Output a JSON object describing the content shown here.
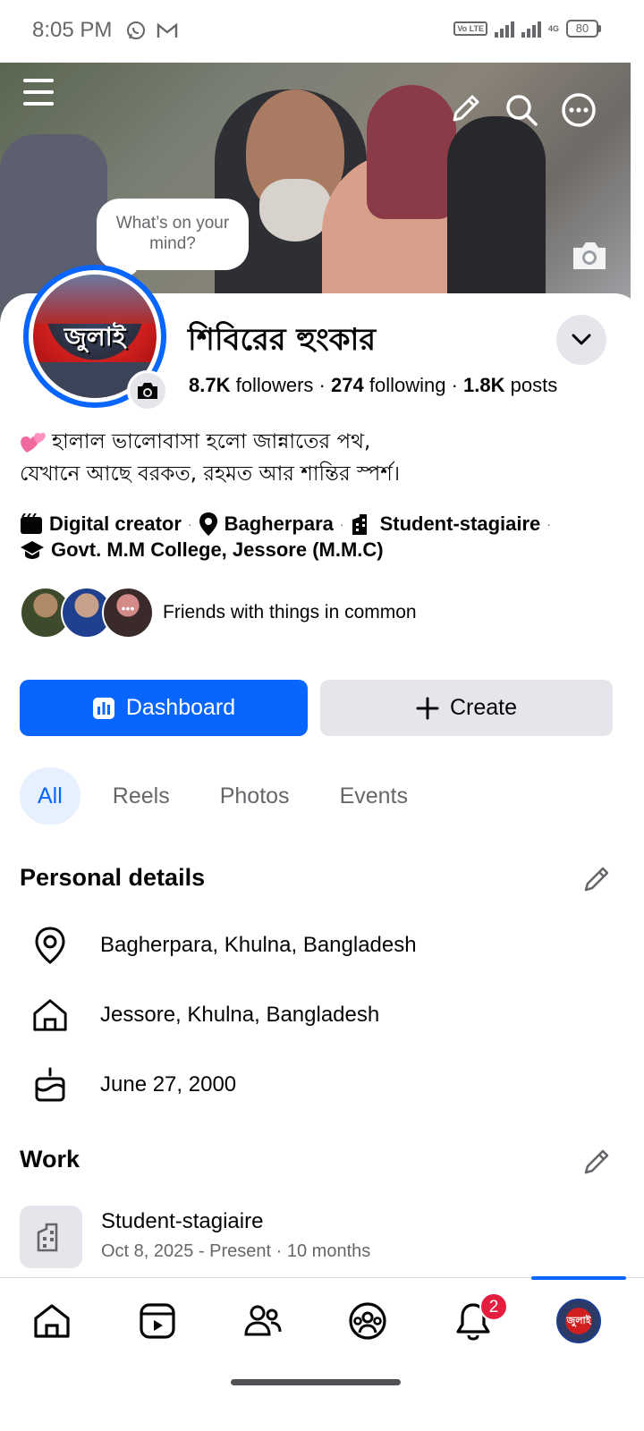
{
  "status_bar": {
    "time": "8:05 PM",
    "left_icons": [
      "whatsapp-icon",
      "gmail-icon"
    ],
    "volte": "Vo LTE",
    "network_label": "4G",
    "battery": "80"
  },
  "cover": {
    "prompt": "What’s on your mind?"
  },
  "profile": {
    "name": "শিবিরের হুংকার",
    "avatar_text": "জুলাই",
    "followers_count": "8.7K",
    "followers_label": "followers",
    "following_count": "274",
    "following_label": "following",
    "posts_count": "1.8K",
    "posts_label": "posts",
    "bio_line1": "হালাল ভালোবাসা হলো জান্নাতের পথ,",
    "bio_line2": "যেখানে আছে বরকত, রহমত আর শান্তির স্পর্শ।",
    "tags": {
      "category": "Digital creator",
      "location": "Bagherpara",
      "work": "Student-stagiaire",
      "education": "Govt. M.M College, Jessore (M.M.C)"
    },
    "friends_text": "Friends with things in common"
  },
  "actions": {
    "dashboard": "Dashboard",
    "create": "Create"
  },
  "tabs": [
    "All",
    "Reels",
    "Photos",
    "Events"
  ],
  "personal_details": {
    "title": "Personal details",
    "lives_in": "Bagherpara, Khulna, Bangladesh",
    "from": "Jessore, Khulna, Bangladesh",
    "birthday": "June 27, 2000"
  },
  "work": {
    "title": "Work",
    "position": "Student-stagiaire",
    "period": "Oct 8, 2025 - Present · 10 months"
  },
  "bottom_nav": {
    "notifications_badge": "2",
    "items": [
      "home-icon",
      "video-icon",
      "friends-icon",
      "groups-icon",
      "bell-icon",
      "profile-avatar"
    ],
    "active_item": "profile-avatar"
  },
  "colors": {
    "accent": "#0866ff",
    "badge": "#e41e3f",
    "secondary_text": "#65676b",
    "button_gray": "#e4e6eb"
  }
}
